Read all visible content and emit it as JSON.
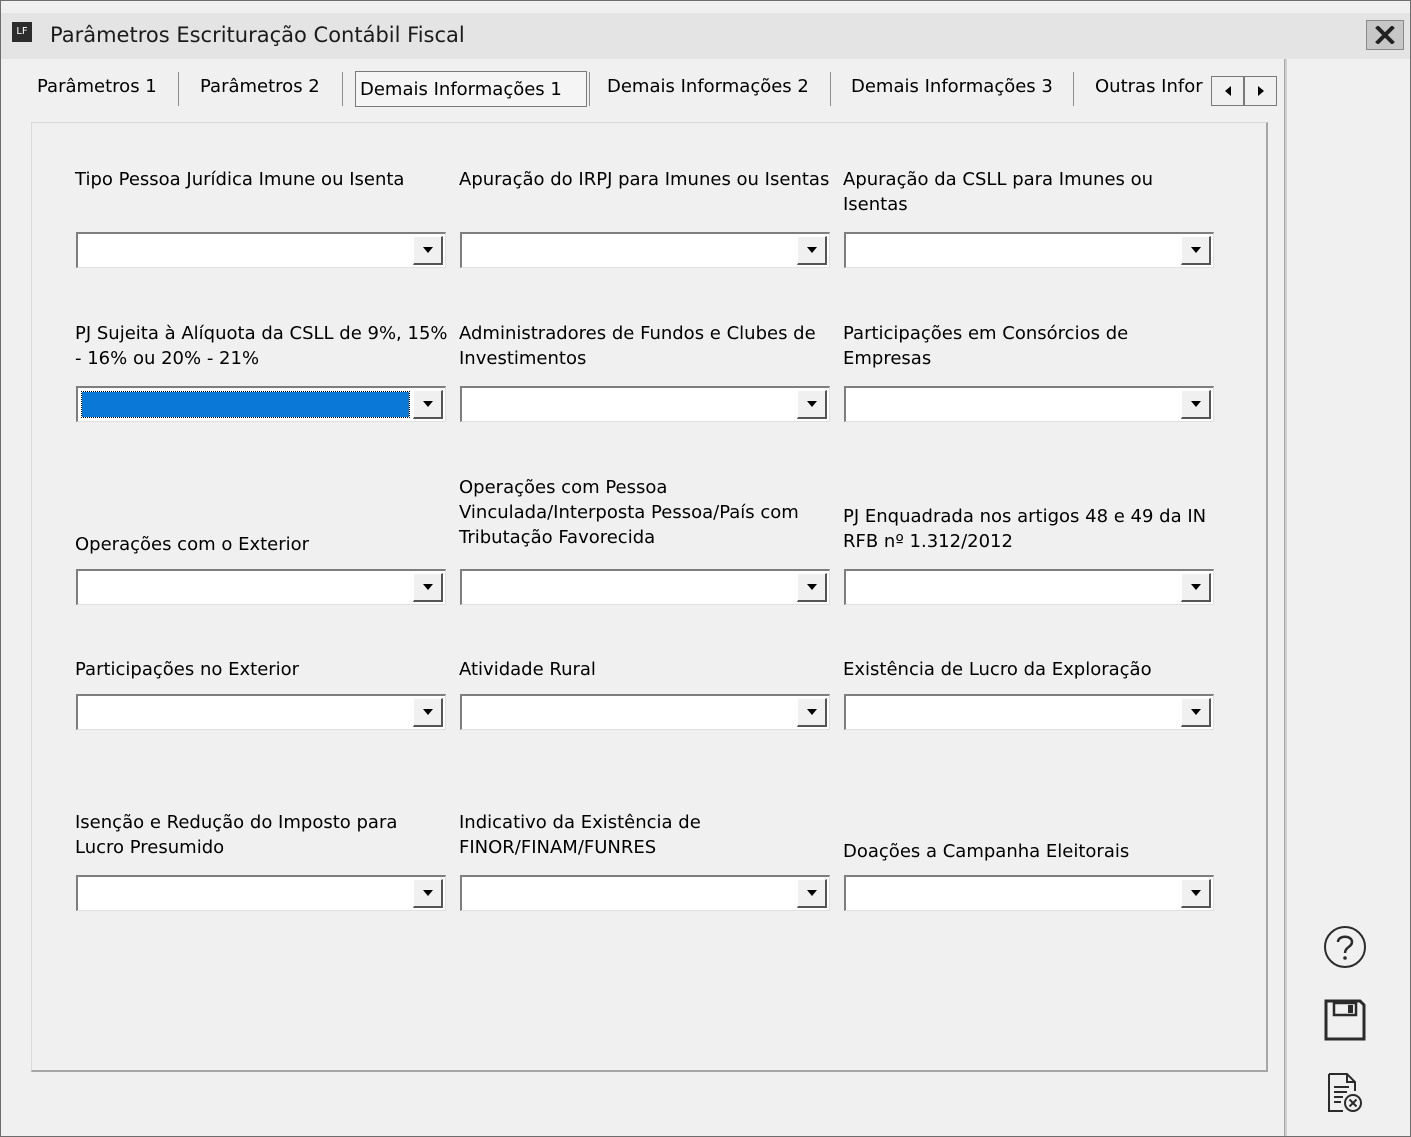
{
  "window": {
    "logo_text": "LF",
    "title": "Parâmetros Escrituração Contábil Fiscal"
  },
  "tabs": [
    {
      "label": "Parâmetros 1",
      "active": false
    },
    {
      "label": "Parâmetros 2",
      "active": false
    },
    {
      "label": "Demais Informações 1",
      "active": true
    },
    {
      "label": "Demais Informações 2",
      "active": false
    },
    {
      "label": "Demais Informações 3",
      "active": false
    },
    {
      "label": "Outras Infor",
      "active": false
    }
  ],
  "fields": {
    "r1c1": {
      "label": "Tipo Pessoa Jurídica Imune ou Isenta",
      "value": ""
    },
    "r1c2": {
      "label": "Apuração do IRPJ para Imunes ou Isentas",
      "value": ""
    },
    "r1c3": {
      "label": "Apuração da CSLL para Imunes ou Isentas",
      "value": ""
    },
    "r2c1": {
      "label": "PJ Sujeita à Alíquota da CSLL de 9%, 15% - 16% ou 20% - 21%",
      "value": ""
    },
    "r2c2": {
      "label": "Administradores de Fundos e Clubes de Investimentos",
      "value": ""
    },
    "r2c3": {
      "label": "Participações em Consórcios de Empresas",
      "value": ""
    },
    "r3c1": {
      "label": "Operações com o Exterior",
      "value": ""
    },
    "r3c2": {
      "label": "Operações com Pessoa Vinculada/Interposta Pessoa/País com Tributação Favorecida",
      "value": ""
    },
    "r3c3": {
      "label": "PJ Enquadrada nos artigos 48 e 49 da IN RFB nº 1.312/2012",
      "value": ""
    },
    "r4c1": {
      "label": "Participações no Exterior",
      "value": ""
    },
    "r4c2": {
      "label": "Atividade Rural",
      "value": ""
    },
    "r4c3": {
      "label": "Existência de Lucro da Exploração",
      "value": ""
    },
    "r5c1": {
      "label": "Isenção e Redução do Imposto para Lucro Presumido",
      "value": ""
    },
    "r5c2": {
      "label": "Indicativo da Existência de FINOR/FINAM/FUNRES",
      "value": ""
    },
    "r5c3": {
      "label": "Doações a Campanha Eleitorais",
      "value": ""
    }
  },
  "colors": {
    "selection": "#0a78d7",
    "background": "#f0f0f0"
  },
  "icons": {
    "help": "help-circle-icon",
    "save": "floppy-disk-icon",
    "cancel": "document-cancel-icon",
    "close": "close-icon"
  }
}
